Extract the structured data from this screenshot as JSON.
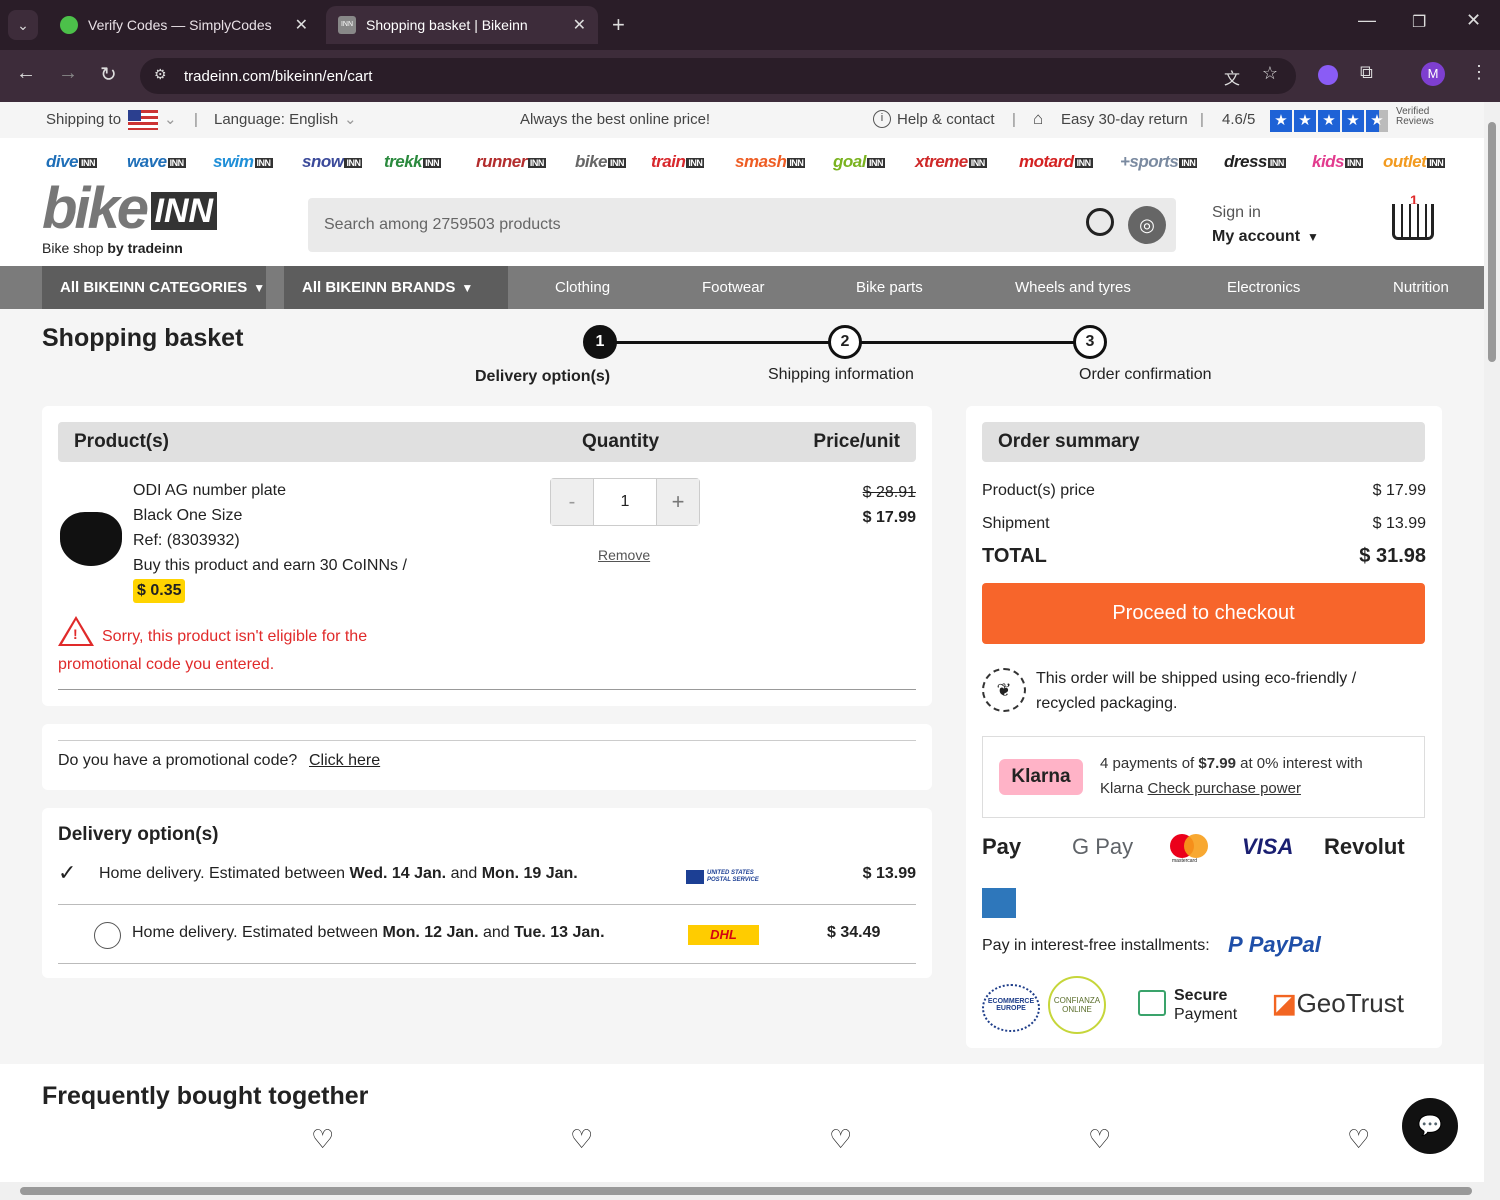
{
  "browser": {
    "tabs": [
      {
        "title": "Verify Codes — SimplyCodes"
      },
      {
        "title": "Shopping basket | Bikeinn"
      }
    ],
    "url": "tradeinn.com/bikeinn/en/cart",
    "profile_initial": "M"
  },
  "topstrip": {
    "shipping_to": "Shipping to",
    "language": "Language: English",
    "tagline": "Always the best online price!",
    "help": "Help & contact",
    "returns": "Easy 30-day return",
    "rating": "4.6/5",
    "verified": "Verified Reviews"
  },
  "brands": [
    "dive",
    "wave",
    "swim",
    "snow",
    "trekk",
    "runner",
    "bike",
    "train",
    "smash",
    "goal",
    "xtreme",
    "motard",
    "+sports",
    "dress",
    "kids",
    "outlet"
  ],
  "brand_suffix": "INN",
  "brand_colors": [
    "#1f6fb8",
    "#1f6fb8",
    "#1f8fd8",
    "#3b4a9a",
    "#2b8a3e",
    "#b32d2d",
    "#666666",
    "#d8282d",
    "#ee5d24",
    "#7ab320",
    "#cf2a2a",
    "#d42222",
    "#7a8aa0",
    "#222222",
    "#e23b8e",
    "#f29a1f"
  ],
  "logo": {
    "name": "bike",
    "badge": "INN",
    "tagline_pre": "Bike shop",
    "tagline_by": "by tradeinn"
  },
  "search": {
    "placeholder": "Search among 2759503 products"
  },
  "account": {
    "sign_in": "Sign in",
    "my_account": "My account",
    "cart_count": "1"
  },
  "nav": {
    "categories": "All BIKEINN CATEGORIES",
    "brands": "All BIKEINN BRANDS",
    "links": [
      "Clothing",
      "Footwear",
      "Bike parts",
      "Wheels and tyres",
      "Electronics",
      "Nutrition"
    ]
  },
  "page_title": "Shopping basket",
  "steps": [
    {
      "num": "1",
      "label": "Delivery option(s)"
    },
    {
      "num": "2",
      "label": "Shipping information"
    },
    {
      "num": "3",
      "label": "Order confirmation"
    }
  ],
  "products": {
    "header": {
      "product": "Product(s)",
      "quantity": "Quantity",
      "price": "Price/unit"
    },
    "item": {
      "name": "ODI AG number plate",
      "variant": "Black One Size",
      "ref": "Ref: (8303932)",
      "coins": "Buy this product and earn 30 CoINNs /",
      "coins_value": "$ 0.35",
      "qty": "1",
      "remove": "Remove",
      "old_price": "$ 28.91",
      "price": "$ 17.99",
      "warning": "Sorry, this product isn't eligible for the",
      "warning2": "promotional code you entered."
    }
  },
  "promo": {
    "question": "Do you have a promotional code?",
    "link": "Click here"
  },
  "delivery": {
    "title": "Delivery option(s)",
    "options": [
      {
        "pre": "Home delivery. Estimated between ",
        "d1": "Wed. 14 Jan.",
        "mid": " and ",
        "d2": "Mon. 19 Jan.",
        "carrier": "UNITED STATES POSTAL SERVICE",
        "price": "$ 13.99"
      },
      {
        "pre": "Home delivery. Estimated between ",
        "d1": "Mon. 12 Jan.",
        "mid": " and ",
        "d2": "Tue. 13 Jan.",
        "carrier": "DHL",
        "price": "$ 34.49"
      }
    ]
  },
  "summary": {
    "title": "Order summary",
    "rows": [
      {
        "label": "Product(s) price",
        "value": "$ 17.99"
      },
      {
        "label": "Shipment",
        "value": "$ 13.99"
      }
    ],
    "total_label": "TOTAL",
    "total_value": "$ 31.98",
    "checkout": "Proceed to checkout",
    "eco": "This order will be shipped using eco-friendly /",
    "eco2": "recycled packaging.",
    "klarna": "Klarna",
    "klarna_pre": "4 payments of ",
    "klarna_amt": "$7.99",
    "klarna_post": " at 0% interest with",
    "klarna_line2": "Klarna ",
    "klarna_link": "Check purchase power",
    "payments": [
      "Pay",
      "G Pay",
      "VISA",
      "Revolut"
    ],
    "mastercard": "mastercard",
    "installments": "Pay in interest-free installments:",
    "paypal": "PayPal",
    "secure1": "Secure",
    "secure2": "Payment",
    "geotrust": "GeoTrust",
    "ecommerce": "ECOMMERCE EUROPE",
    "confianza": "CONFIANZA ONLINE"
  },
  "fbt": {
    "title": "Frequently bought together"
  },
  "colors": {
    "accent": "#f7652b",
    "warning": "#e02a2a",
    "coins_badge": "#ffd400",
    "klarna_pink": "#ffb3c7",
    "paypal_blue": "#1f4fa8"
  }
}
